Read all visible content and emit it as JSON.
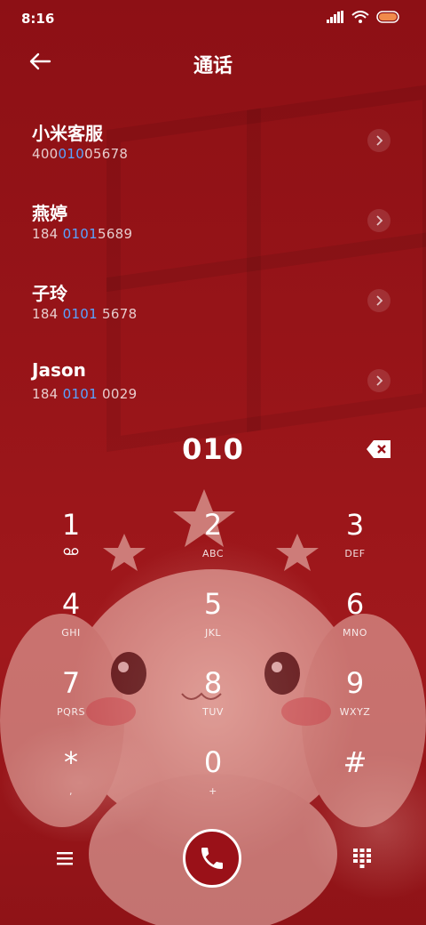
{
  "status": {
    "time": "8:16"
  },
  "header": {
    "title": "通话"
  },
  "contacts": [
    {
      "name": "小米客服",
      "num_pre": "400",
      "num_hl": "010",
      "num_post": "05678"
    },
    {
      "name": "燕婷",
      "num_pre": "184 ",
      "num_hl": "0101",
      "num_post": "5689"
    },
    {
      "name": "子玲",
      "num_pre": "184 ",
      "num_hl": "0101",
      "num_post": " 5678"
    },
    {
      "name": "Jason",
      "num_pre": "184 ",
      "num_hl": "0101",
      "num_post": " 0029"
    }
  ],
  "dialer": {
    "input": "010",
    "keys": [
      {
        "d": "1",
        "s": ""
      },
      {
        "d": "2",
        "s": "ABC"
      },
      {
        "d": "3",
        "s": "DEF"
      },
      {
        "d": "4",
        "s": "GHI"
      },
      {
        "d": "5",
        "s": "JKL"
      },
      {
        "d": "6",
        "s": "MNO"
      },
      {
        "d": "7",
        "s": "PQRS"
      },
      {
        "d": "8",
        "s": "TUV"
      },
      {
        "d": "9",
        "s": "WXYZ"
      },
      {
        "d": "*",
        "s": ","
      },
      {
        "d": "0",
        "s": "+"
      },
      {
        "d": "#",
        "s": ""
      }
    ]
  },
  "icons": {
    "back": "arrow-left-icon",
    "backspace": "backspace-icon",
    "voicemail": "voicemail-icon",
    "call": "phone-icon",
    "menu": "menu-icon",
    "keypad": "keypad-icon"
  },
  "colors": {
    "highlight": "#59a3ff",
    "background": "#8f1217"
  }
}
